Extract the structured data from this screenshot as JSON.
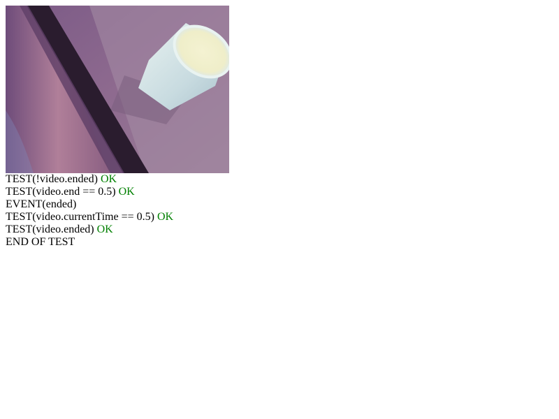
{
  "video": {
    "icon": "video-frame-cup"
  },
  "log": {
    "line1": {
      "text": "TEST(!video.ended) ",
      "status": "OK"
    },
    "line2": {
      "text": "TEST(video.end == 0.5) ",
      "status": "OK"
    },
    "line3": {
      "text": "EVENT(ended)"
    },
    "line4": {
      "text": "TEST(video.currentTime == 0.5) ",
      "status": "OK"
    },
    "line5": {
      "text": "TEST(video.ended) ",
      "status": "OK"
    },
    "line6": {
      "text": "END OF TEST"
    }
  },
  "colors": {
    "ok": "#008000",
    "text": "#000000",
    "background": "#ffffff"
  }
}
